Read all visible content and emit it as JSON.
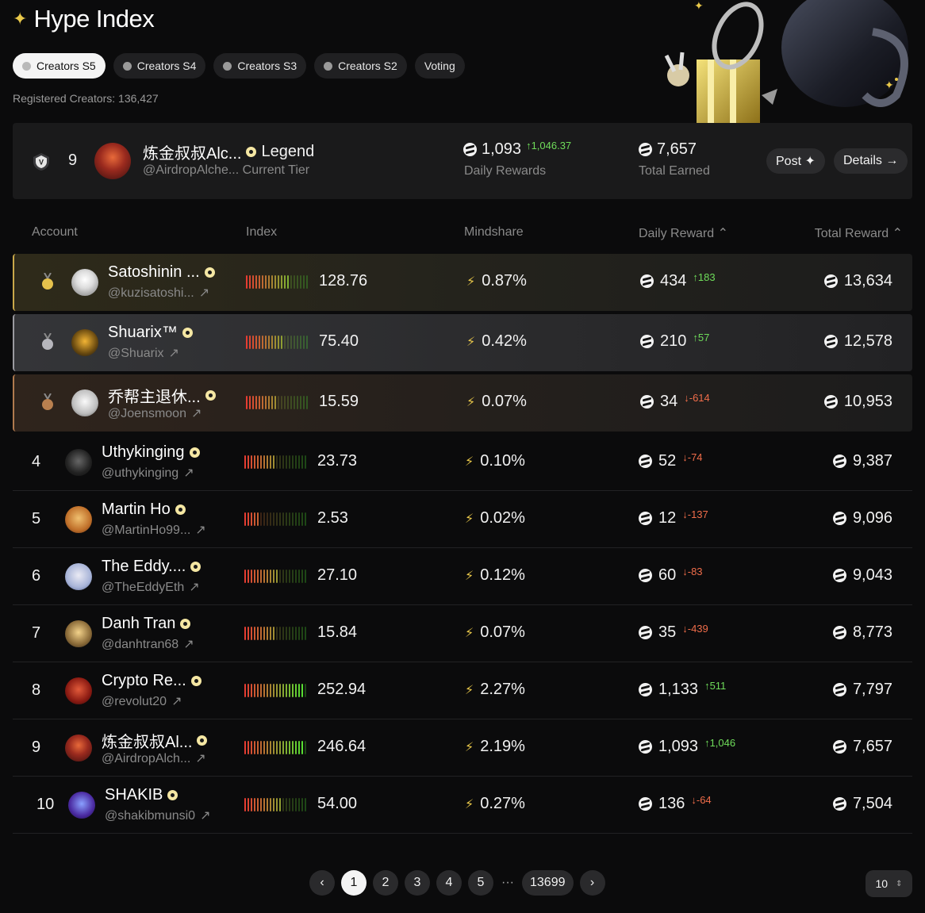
{
  "header": {
    "title": "Hype Index",
    "registered": "Registered Creators: 136,427"
  },
  "tabs": [
    {
      "label": "Creators S5",
      "icon": "S5",
      "active": true
    },
    {
      "label": "Creators S4",
      "icon": "IV",
      "active": false
    },
    {
      "label": "Creators S3",
      "icon": "III",
      "active": false
    },
    {
      "label": "Creators S2",
      "icon": "II",
      "active": false
    },
    {
      "label": "Voting",
      "icon": "",
      "active": false
    }
  ],
  "my_card": {
    "tier_icon": "V",
    "rank": "9",
    "name": "炼金叔叔Alc...",
    "handle": "@AirdropAlche...",
    "tier": "Legend",
    "tier_label": "Current Tier",
    "daily_rewards": "1,093",
    "daily_change": "↑1,046.37",
    "daily_label": "Daily Rewards",
    "total_earned": "7,657",
    "total_label": "Total Earned",
    "post_label": "Post ✦",
    "details_label": "Details →"
  },
  "table": {
    "headers": {
      "account": "Account",
      "index": "Index",
      "mindshare": "Mindshare",
      "daily_reward": "Daily Reward ⌃",
      "total_reward": "Total Reward ⌃"
    },
    "rows": [
      {
        "rank": "1",
        "name": "Satoshinin ...",
        "handle": "@kuzisatoshi...",
        "index": "128.76",
        "score": 0.72,
        "mindshare": "0.87%",
        "daily": "434",
        "change": "↑183",
        "dir": "up",
        "total": "13,634"
      },
      {
        "rank": "2",
        "name": "Shuarix™",
        "handle": "@Shuarix",
        "index": "75.40",
        "score": 0.62,
        "mindshare": "0.42%",
        "daily": "210",
        "change": "↑57",
        "dir": "up",
        "total": "12,578"
      },
      {
        "rank": "3",
        "name": "乔帮主退休...",
        "handle": "@Joensmoon",
        "index": "15.59",
        "score": 0.5,
        "mindshare": "0.07%",
        "daily": "34",
        "change": "↓-614",
        "dir": "down",
        "total": "10,953"
      },
      {
        "rank": "4",
        "name": "Uthykinging",
        "handle": "@uthykinging",
        "index": "23.73",
        "score": 0.52,
        "mindshare": "0.10%",
        "daily": "52",
        "change": "↓-74",
        "dir": "down",
        "total": "9,387"
      },
      {
        "rank": "5",
        "name": "Martin Ho",
        "handle": "@MartinHo99...",
        "index": "2.53",
        "score": 0.25,
        "mindshare": "0.02%",
        "daily": "12",
        "change": "↓-137",
        "dir": "down",
        "total": "9,096"
      },
      {
        "rank": "6",
        "name": "The Eddy....",
        "handle": "@TheEddyEth",
        "index": "27.10",
        "score": 0.55,
        "mindshare": "0.12%",
        "daily": "60",
        "change": "↓-83",
        "dir": "down",
        "total": "9,043"
      },
      {
        "rank": "7",
        "name": "Danh Tran",
        "handle": "@danhtran68",
        "index": "15.84",
        "score": 0.5,
        "mindshare": "0.07%",
        "daily": "35",
        "change": "↓-439",
        "dir": "down",
        "total": "8,773"
      },
      {
        "rank": "8",
        "name": "Crypto Re...",
        "handle": "@revolut20",
        "index": "252.94",
        "score": 0.95,
        "mindshare": "2.27%",
        "daily": "1,133",
        "change": "↑511",
        "dir": "up",
        "total": "7,797"
      },
      {
        "rank": "9",
        "name": "炼金叔叔Al...",
        "handle": "@AirdropAlch...",
        "index": "246.64",
        "score": 0.95,
        "mindshare": "2.19%",
        "daily": "1,093",
        "change": "↑1,046",
        "dir": "up",
        "total": "7,657"
      },
      {
        "rank": "10",
        "name": "SHAKIB",
        "handle": "@shakibmunsi0",
        "index": "54.00",
        "score": 0.62,
        "mindshare": "0.27%",
        "daily": "136",
        "change": "↓-64",
        "dir": "down",
        "total": "7,504"
      }
    ]
  },
  "pagination": {
    "prev": "‹",
    "pages": [
      "1",
      "2",
      "3",
      "4",
      "5"
    ],
    "current": "1",
    "ellipsis": "···",
    "last": "13699",
    "next": "›",
    "page_size": "10"
  },
  "colors": {
    "accent": "#e9c84a",
    "up": "#6fdc5a",
    "down": "#f06d4a",
    "gold": "#c9a84a",
    "silver": "#9a9aa0",
    "bronze": "#b07a4e"
  }
}
